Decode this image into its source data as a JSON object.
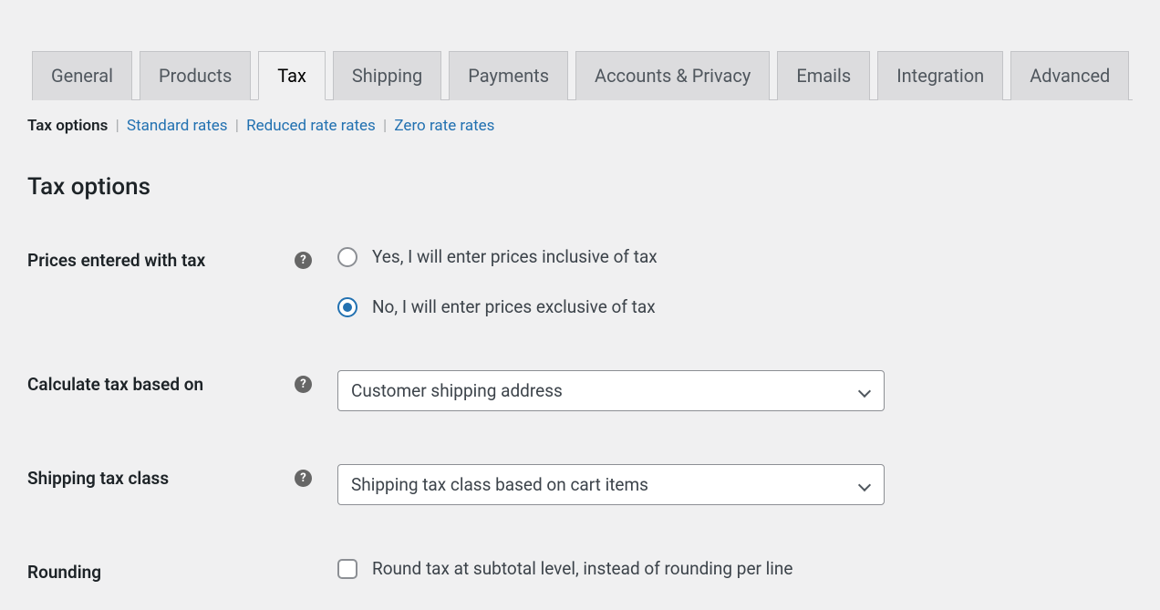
{
  "tabs": [
    {
      "label": "General"
    },
    {
      "label": "Products"
    },
    {
      "label": "Tax"
    },
    {
      "label": "Shipping"
    },
    {
      "label": "Payments"
    },
    {
      "label": "Accounts & Privacy"
    },
    {
      "label": "Emails"
    },
    {
      "label": "Integration"
    },
    {
      "label": "Advanced"
    }
  ],
  "subtabs": {
    "current": "Tax options",
    "links": [
      "Standard rates",
      "Reduced rate rates",
      "Zero rate rates"
    ]
  },
  "section_title": "Tax options",
  "fields": {
    "prices_with_tax": {
      "label": "Prices entered with tax",
      "option_yes": "Yes, I will enter prices inclusive of tax",
      "option_no": "No, I will enter prices exclusive of tax"
    },
    "calc_based_on": {
      "label": "Calculate tax based on",
      "value": "Customer shipping address"
    },
    "shipping_tax_class": {
      "label": "Shipping tax class",
      "value": "Shipping tax class based on cart items"
    },
    "rounding": {
      "label": "Rounding",
      "checkbox": "Round tax at subtotal level, instead of rounding per line"
    }
  }
}
